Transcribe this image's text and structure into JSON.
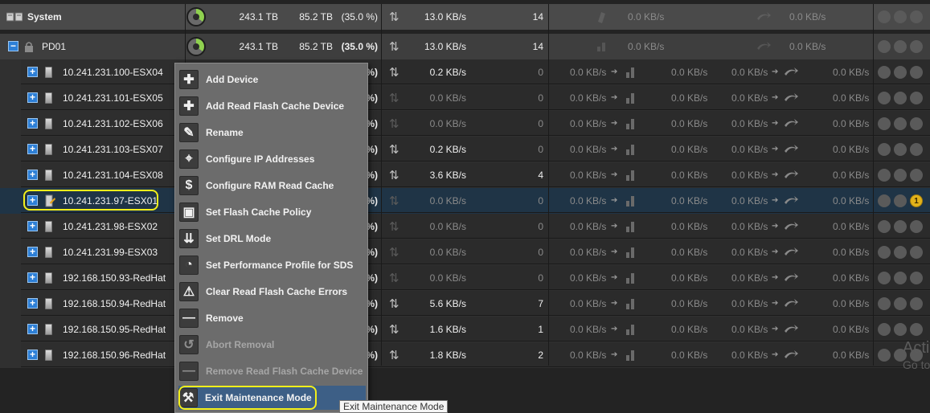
{
  "system": {
    "label": "System",
    "capacity": "243.1 TB",
    "used": "85.2 TB",
    "used_pct": "(35.0 %)",
    "bandwidth": "13.0 KB/s",
    "iops": "14",
    "rebuild_bw": "0.0 KB/s",
    "rebalance_bw": "0.0 KB/s"
  },
  "domain": {
    "label": "PD01",
    "capacity": "243.1 TB",
    "used": "85.2 TB",
    "used_pct": "(35.0 %)",
    "bandwidth": "13.0 KB/s",
    "iops": "14",
    "rebuild_bw": "0.0 KB/s",
    "rebalance_bw": "0.0 KB/s"
  },
  "nodes": [
    {
      "name": "10.241.231.100-ESX04",
      "pct_tail": "%)",
      "bw": "0.2 KB/s",
      "iops": "0",
      "c1": "0.0 KB/s",
      "c2": "0.0 KB/s",
      "c3": "0.0 KB/s",
      "c4": "0.0 KB/s"
    },
    {
      "name": "10.241.231.101-ESX05",
      "pct_tail": "%)",
      "bw": "0.0 KB/s",
      "iops": "0",
      "c1": "0.0 KB/s",
      "c2": "0.0 KB/s",
      "c3": "0.0 KB/s",
      "c4": "0.0 KB/s"
    },
    {
      "name": "10.241.231.102-ESX06",
      "pct_tail": "%)",
      "bw": "0.0 KB/s",
      "iops": "0",
      "c1": "0.0 KB/s",
      "c2": "0.0 KB/s",
      "c3": "0.0 KB/s",
      "c4": "0.0 KB/s"
    },
    {
      "name": "10.241.231.103-ESX07",
      "pct_tail": "%)",
      "bw": "0.2 KB/s",
      "iops": "0",
      "c1": "0.0 KB/s",
      "c2": "0.0 KB/s",
      "c3": "0.0 KB/s",
      "c4": "0.0 KB/s"
    },
    {
      "name": "10.241.231.104-ESX08",
      "pct_tail": "%)",
      "bw": "3.6 KB/s",
      "iops": "4",
      "c1": "0.0 KB/s",
      "c2": "0.0 KB/s",
      "c3": "0.0 KB/s",
      "c4": "0.0 KB/s"
    },
    {
      "name": "10.241.231.97-ESX01",
      "pct_tail": "%)",
      "bw": "0.0 KB/s",
      "iops": "0",
      "c1": "0.0 KB/s",
      "c2": "0.0 KB/s",
      "c3": "0.0 KB/s",
      "c4": "0.0 KB/s",
      "alert": "1"
    },
    {
      "name": "10.241.231.98-ESX02",
      "pct_tail": "%)",
      "bw": "0.0 KB/s",
      "iops": "0",
      "c1": "0.0 KB/s",
      "c2": "0.0 KB/s",
      "c3": "0.0 KB/s",
      "c4": "0.0 KB/s"
    },
    {
      "name": "10.241.231.99-ESX03",
      "pct_tail": "%)",
      "bw": "0.0 KB/s",
      "iops": "0",
      "c1": "0.0 KB/s",
      "c2": "0.0 KB/s",
      "c3": "0.0 KB/s",
      "c4": "0.0 KB/s"
    },
    {
      "name": "192.168.150.93-RedHat",
      "pct_tail": "%)",
      "bw": "0.0 KB/s",
      "iops": "0",
      "c1": "0.0 KB/s",
      "c2": "0.0 KB/s",
      "c3": "0.0 KB/s",
      "c4": "0.0 KB/s"
    },
    {
      "name": "192.168.150.94-RedHat",
      "pct_tail": "%)",
      "bw": "5.6 KB/s",
      "iops": "7",
      "c1": "0.0 KB/s",
      "c2": "0.0 KB/s",
      "c3": "0.0 KB/s",
      "c4": "0.0 KB/s"
    },
    {
      "name": "192.168.150.95-RedHat",
      "pct_tail": "%)",
      "bw": "1.6 KB/s",
      "iops": "1",
      "c1": "0.0 KB/s",
      "c2": "0.0 KB/s",
      "c3": "0.0 KB/s",
      "c4": "0.0 KB/s"
    },
    {
      "name": "192.168.150.96-RedHat",
      "pct_tail": "%)",
      "bw": "1.8 KB/s",
      "iops": "2",
      "c1": "0.0 KB/s",
      "c2": "0.0 KB/s",
      "c3": "0.0 KB/s",
      "c4": "0.0 KB/s"
    }
  ],
  "menu": {
    "items": [
      {
        "label": "Add Device",
        "icon": "plus-icon",
        "glyph": "✚",
        "disabled": false
      },
      {
        "label": "Add Read Flash Cache Device",
        "icon": "plus-icon",
        "glyph": "✚",
        "disabled": false
      },
      {
        "label": "Rename",
        "icon": "pencil-icon",
        "glyph": "✎",
        "disabled": false
      },
      {
        "label": "Configure IP Addresses",
        "icon": "tag-icon",
        "glyph": "⌖",
        "disabled": false
      },
      {
        "label": "Configure RAM Read Cache",
        "icon": "dollar-icon",
        "glyph": "$",
        "disabled": false
      },
      {
        "label": "Set Flash Cache Policy",
        "icon": "chip-icon",
        "glyph": "▣",
        "disabled": false
      },
      {
        "label": "Set DRL Mode",
        "icon": "drl-icon",
        "glyph": "⇊",
        "disabled": false
      },
      {
        "label": "Set Performance Profile for SDS",
        "icon": "gauge-icon",
        "glyph": "◔",
        "disabled": false
      },
      {
        "label": "Clear Read Flash Cache Errors",
        "icon": "warning-icon",
        "glyph": "⚠",
        "disabled": false
      },
      {
        "label": "Remove",
        "icon": "minus-icon",
        "glyph": "—",
        "disabled": false
      },
      {
        "label": "Abort Removal",
        "icon": "abort-icon",
        "glyph": "↺",
        "disabled": true
      },
      {
        "label": "Remove Read Flash Cache Device",
        "icon": "minus-icon",
        "glyph": "—",
        "disabled": true
      },
      {
        "label": "Exit Maintenance Mode",
        "icon": "wrench-icon",
        "glyph": "⚒",
        "disabled": false,
        "highlighted": true
      }
    ]
  },
  "tooltip": "Exit Maintenance Mode",
  "watermark": {
    "line1": "Acti",
    "line2": "Go to"
  },
  "colors": {
    "accent": "#2d7fd6",
    "highlight_ring": "#f2ef1a",
    "selected_row": "#1f3446",
    "alert_badge": "#e2b21a",
    "menu_bg": "#6c6c6c"
  }
}
